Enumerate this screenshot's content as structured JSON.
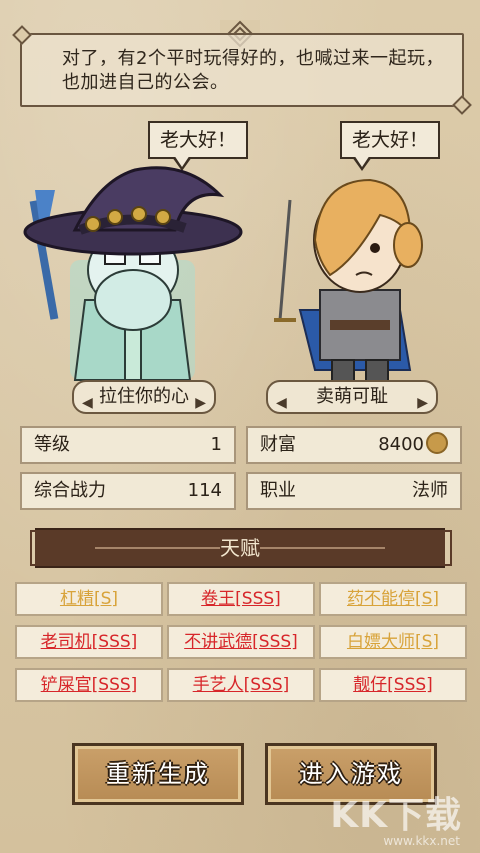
{
  "dialog": {
    "line1": "对了，有2个平时玩得好的，也喊过来一起玩，",
    "line2": "也加进自己的公会。"
  },
  "bubbles": {
    "left": "老大好！",
    "right": "老大好！"
  },
  "characters": {
    "left_name": "拉住你的心",
    "right_name": "卖萌可耻"
  },
  "stats": {
    "level_label": "等级",
    "level_value": "1",
    "wealth_label": "财富",
    "wealth_value": "8400",
    "power_label": "综合战力",
    "power_value": "114",
    "job_label": "职业",
    "job_value": "法师"
  },
  "talents": {
    "title": "天赋",
    "items": [
      {
        "text": "杠精[S]",
        "color": "#d8a33a"
      },
      {
        "text": "卷王[SSS]",
        "color": "#d7262a"
      },
      {
        "text": "药不能停[S]",
        "color": "#d8a33a"
      },
      {
        "text": "老司机[SSS]",
        "color": "#d7262a"
      },
      {
        "text": "不讲武德[SSS]",
        "color": "#d7262a"
      },
      {
        "text": "白嫖大师[S]",
        "color": "#d8a33a"
      },
      {
        "text": "铲屎官[SSS]",
        "color": "#d7262a"
      },
      {
        "text": "手艺人[SSS]",
        "color": "#d7262a"
      },
      {
        "text": "靓仔[SSS]",
        "color": "#d7262a"
      }
    ]
  },
  "buttons": {
    "regenerate": "重新生成",
    "enter": "进入游戏"
  },
  "watermark": {
    "logo": "KK下载",
    "url": "www.kkx.net"
  }
}
